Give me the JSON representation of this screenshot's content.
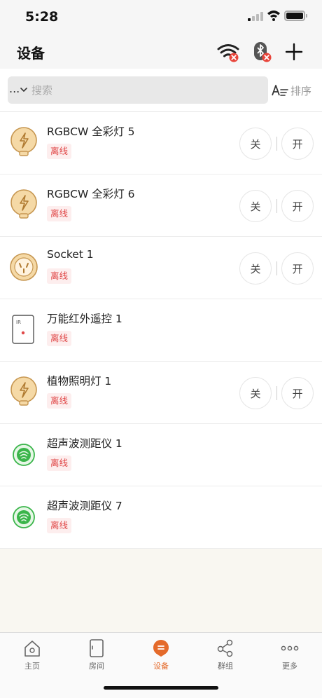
{
  "status_bar": {
    "time": "5:28"
  },
  "header": {
    "title": "设备",
    "icons": [
      "wifi-disconnected-icon",
      "bluetooth-disconnected-icon",
      "plus-icon"
    ]
  },
  "search": {
    "filter_label": "...",
    "placeholder": "搜索",
    "sort_label": "排序"
  },
  "devices": [
    {
      "name": "RGBCW 全彩灯 5",
      "status": "离线",
      "icon": "bulb-icon",
      "off_label": "关",
      "on_label": "开"
    },
    {
      "name": "RGBCW 全彩灯 6",
      "status": "离线",
      "icon": "bulb-icon",
      "off_label": "关",
      "on_label": "开"
    },
    {
      "name": "Socket 1",
      "status": "离线",
      "icon": "socket-icon",
      "off_label": "关",
      "on_label": "开"
    },
    {
      "name": "万能红外遥控 1",
      "status": "离线",
      "icon": "ir-remote-icon",
      "ir_text": "IR"
    },
    {
      "name": "植物照明灯 1",
      "status": "离线",
      "icon": "bulb-icon",
      "off_label": "关",
      "on_label": "开"
    },
    {
      "name": "超声波测距仪 1",
      "status": "离线",
      "icon": "ultrasonic-sensor-icon"
    },
    {
      "name": "超声波测距仪 7",
      "status": "离线",
      "icon": "ultrasonic-sensor-icon"
    }
  ],
  "tab_bar": {
    "active": "设备",
    "tabs": [
      {
        "label": "主页",
        "icon": "home-icon"
      },
      {
        "label": "房间",
        "icon": "door-icon"
      },
      {
        "label": "设备",
        "icon": "device-icon"
      },
      {
        "label": "群组",
        "icon": "share-nodes-icon"
      },
      {
        "label": "更多",
        "icon": "more-dots-icon"
      }
    ]
  },
  "colors": {
    "accent": "#e46a2a",
    "offline_text": "#e04848",
    "offline_bg": "#fdeeee",
    "bulb": "#f5d9a6",
    "sensor": "#3ab54a"
  }
}
